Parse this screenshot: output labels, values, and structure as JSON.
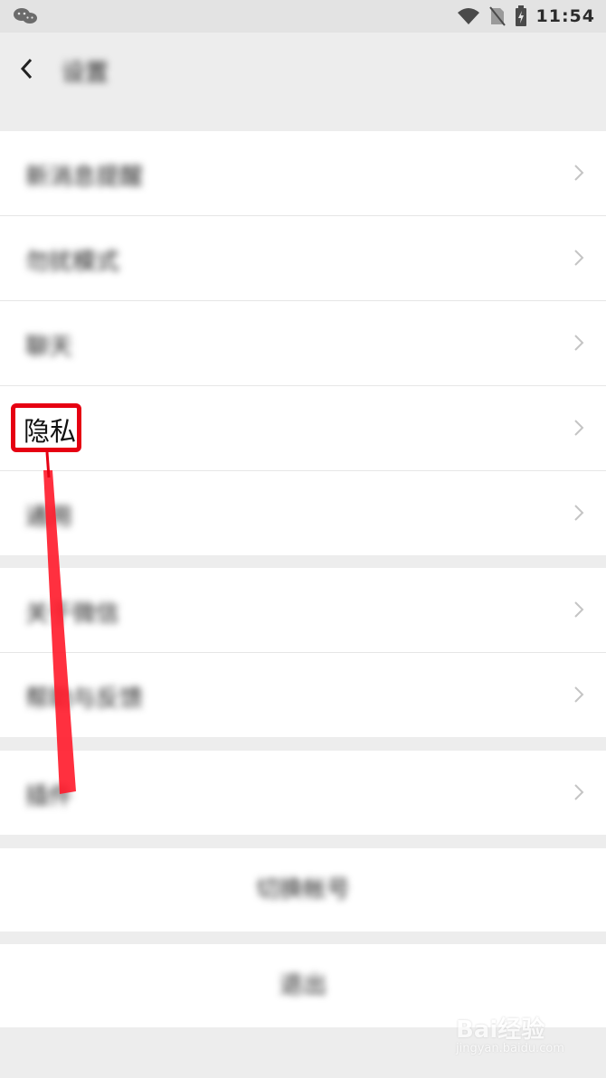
{
  "status_bar": {
    "time": "11:54"
  },
  "nav": {
    "title": "设置"
  },
  "groups": [
    {
      "items": [
        {
          "label": "新消息提醒"
        },
        {
          "label": "勿扰模式"
        },
        {
          "label": "聊天"
        },
        {
          "label": "隐私"
        },
        {
          "label": "通用"
        }
      ]
    },
    {
      "items": [
        {
          "label": "关于微信"
        },
        {
          "label": "帮助与反馈"
        }
      ]
    },
    {
      "items": [
        {
          "label": "插件"
        }
      ]
    }
  ],
  "actions": {
    "switch_account": "切换帐号",
    "logout": "退出"
  },
  "highlight": {
    "label": "隐私"
  },
  "watermark": {
    "brand": "Bai经验",
    "url": "jingyan.baidu.com"
  },
  "colors": {
    "highlight": "#e60012",
    "background": "#ededed",
    "row": "#ffffff"
  }
}
